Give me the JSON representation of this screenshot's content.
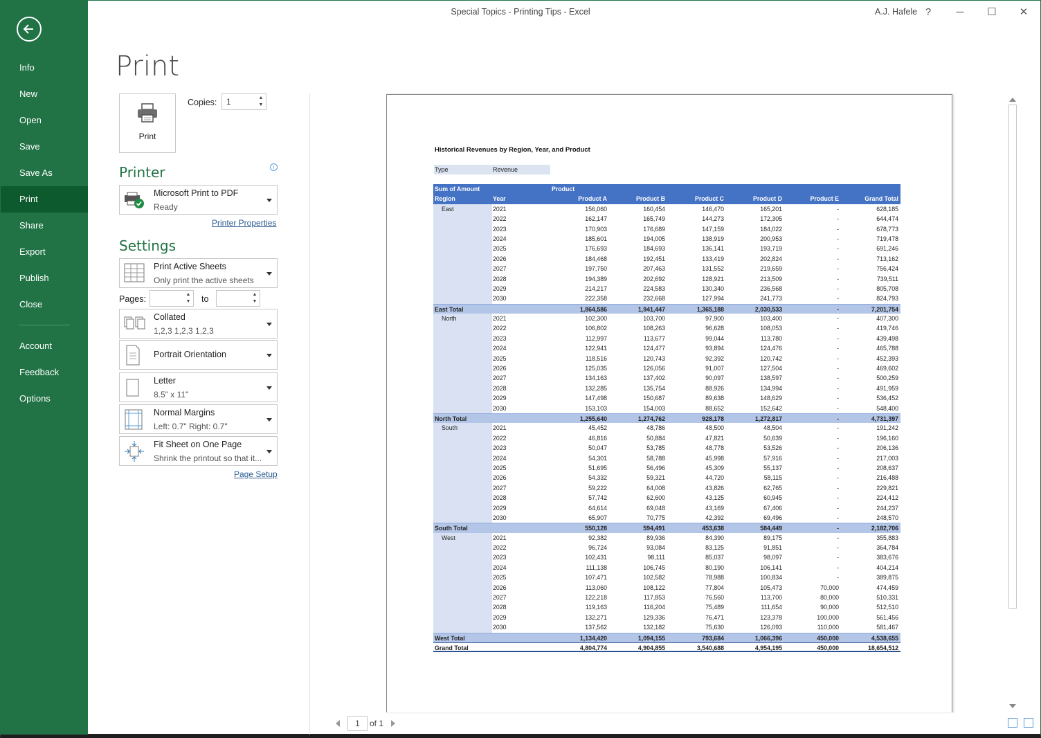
{
  "window": {
    "title": "Special Topics - Printing Tips  -  Excel",
    "user": "A.J. Hafele",
    "help": "?",
    "minimize": "─",
    "maximize": "☐",
    "close": "✕"
  },
  "nav": {
    "items": [
      {
        "label": "Info"
      },
      {
        "label": "New"
      },
      {
        "label": "Open"
      },
      {
        "label": "Save"
      },
      {
        "label": "Save As"
      },
      {
        "label": "Print",
        "active": true
      },
      {
        "label": "Share"
      },
      {
        "label": "Export"
      },
      {
        "label": "Publish"
      },
      {
        "label": "Close"
      },
      {
        "label": "Account"
      },
      {
        "label": "Feedback"
      },
      {
        "label": "Options"
      }
    ]
  },
  "print": {
    "heading": "Print",
    "button_label": "Print",
    "copies_label": "Copies:",
    "copies_value": "1",
    "printer_title": "Printer",
    "printer_name": "Microsoft Print to PDF",
    "printer_status": "Ready",
    "printer_properties": "Printer Properties",
    "settings_title": "Settings",
    "what_to_print": "Print Active Sheets",
    "what_to_print_desc": "Only print the active sheets",
    "pages_label": "Pages:",
    "pages_from": "",
    "pages_to_label": "to",
    "pages_to": "",
    "collation": "Collated",
    "collation_desc": "1,2,3    1,2,3    1,2,3",
    "orientation": "Portrait Orientation",
    "paper": "Letter",
    "paper_desc": "8.5\" x 11\"",
    "margins": "Normal Margins",
    "margins_desc": "Left:  0.7\"    Right:  0.7\"",
    "scaling": "Fit Sheet on One Page",
    "scaling_desc": "Shrink the printout so that it...",
    "page_setup": "Page Setup"
  },
  "pager": {
    "current": "1",
    "of": "of 1"
  },
  "report": {
    "title": "Historical Revenues by Region, Year, and Product",
    "type_label": "Type",
    "type_value": "Revenue",
    "header1": {
      "a": "Sum of Amount",
      "b": "Product"
    },
    "header2": [
      "Region",
      "Year",
      "Product A",
      "Product B",
      "Product C",
      "Product D",
      "Product E",
      "Grand Total"
    ],
    "rows": [
      {
        "kind": "dat",
        "cells": [
          "East",
          "2021",
          "156,060",
          "160,454",
          "146,470",
          "165,201",
          "-",
          "628,185"
        ]
      },
      {
        "kind": "dat",
        "cells": [
          "",
          "2022",
          "162,147",
          "165,749",
          "144,273",
          "172,305",
          "-",
          "644,474"
        ]
      },
      {
        "kind": "dat",
        "cells": [
          "",
          "2023",
          "170,903",
          "176,689",
          "147,159",
          "184,022",
          "-",
          "678,773"
        ]
      },
      {
        "kind": "dat",
        "cells": [
          "",
          "2024",
          "185,601",
          "194,005",
          "138,919",
          "200,953",
          "-",
          "719,478"
        ]
      },
      {
        "kind": "dat",
        "cells": [
          "",
          "2025",
          "176,693",
          "184,693",
          "136,141",
          "193,719",
          "-",
          "691,246"
        ]
      },
      {
        "kind": "dat",
        "cells": [
          "",
          "2026",
          "184,468",
          "192,451",
          "133,419",
          "202,824",
          "-",
          "713,162"
        ]
      },
      {
        "kind": "dat",
        "cells": [
          "",
          "2027",
          "197,750",
          "207,463",
          "131,552",
          "219,659",
          "-",
          "756,424"
        ]
      },
      {
        "kind": "dat",
        "cells": [
          "",
          "2028",
          "194,389",
          "202,692",
          "128,921",
          "213,509",
          "-",
          "739,511"
        ]
      },
      {
        "kind": "dat",
        "cells": [
          "",
          "2029",
          "214,217",
          "224,583",
          "130,340",
          "236,568",
          "-",
          "805,708"
        ]
      },
      {
        "kind": "dat",
        "cells": [
          "",
          "2030",
          "222,358",
          "232,668",
          "127,994",
          "241,773",
          "-",
          "824,793"
        ]
      },
      {
        "kind": "sub",
        "cells": [
          "East Total",
          "",
          "1,864,586",
          "1,941,447",
          "1,365,188",
          "2,030,533",
          "-",
          "7,201,754"
        ]
      },
      {
        "kind": "dat",
        "cells": [
          "North",
          "2021",
          "102,300",
          "103,700",
          "97,900",
          "103,400",
          "-",
          "407,300"
        ]
      },
      {
        "kind": "dat",
        "cells": [
          "",
          "2022",
          "106,802",
          "108,263",
          "96,628",
          "108,053",
          "-",
          "419,746"
        ]
      },
      {
        "kind": "dat",
        "cells": [
          "",
          "2023",
          "112,997",
          "113,677",
          "99,044",
          "113,780",
          "-",
          "439,498"
        ]
      },
      {
        "kind": "dat",
        "cells": [
          "",
          "2024",
          "122,941",
          "124,477",
          "93,894",
          "124,476",
          "-",
          "465,788"
        ]
      },
      {
        "kind": "dat",
        "cells": [
          "",
          "2025",
          "118,516",
          "120,743",
          "92,392",
          "120,742",
          "-",
          "452,393"
        ]
      },
      {
        "kind": "dat",
        "cells": [
          "",
          "2026",
          "125,035",
          "126,056",
          "91,007",
          "127,504",
          "-",
          "469,602"
        ]
      },
      {
        "kind": "dat",
        "cells": [
          "",
          "2027",
          "134,163",
          "137,402",
          "90,097",
          "138,597",
          "-",
          "500,259"
        ]
      },
      {
        "kind": "dat",
        "cells": [
          "",
          "2028",
          "132,285",
          "135,754",
          "88,926",
          "134,994",
          "-",
          "491,959"
        ]
      },
      {
        "kind": "dat",
        "cells": [
          "",
          "2029",
          "147,498",
          "150,687",
          "89,638",
          "148,629",
          "-",
          "536,452"
        ]
      },
      {
        "kind": "dat",
        "cells": [
          "",
          "2030",
          "153,103",
          "154,003",
          "88,652",
          "152,642",
          "-",
          "548,400"
        ]
      },
      {
        "kind": "sub",
        "cells": [
          "North Total",
          "",
          "1,255,640",
          "1,274,762",
          "928,178",
          "1,272,817",
          "-",
          "4,731,397"
        ]
      },
      {
        "kind": "dat",
        "cells": [
          "South",
          "2021",
          "45,452",
          "48,786",
          "48,500",
          "48,504",
          "-",
          "191,242"
        ]
      },
      {
        "kind": "dat",
        "cells": [
          "",
          "2022",
          "46,816",
          "50,884",
          "47,821",
          "50,639",
          "-",
          "196,160"
        ]
      },
      {
        "kind": "dat",
        "cells": [
          "",
          "2023",
          "50,047",
          "53,785",
          "48,778",
          "53,526",
          "-",
          "206,136"
        ]
      },
      {
        "kind": "dat",
        "cells": [
          "",
          "2024",
          "54,301",
          "58,788",
          "45,998",
          "57,916",
          "-",
          "217,003"
        ]
      },
      {
        "kind": "dat",
        "cells": [
          "",
          "2025",
          "51,695",
          "56,496",
          "45,309",
          "55,137",
          "-",
          "208,637"
        ]
      },
      {
        "kind": "dat",
        "cells": [
          "",
          "2026",
          "54,332",
          "59,321",
          "44,720",
          "58,115",
          "-",
          "216,488"
        ]
      },
      {
        "kind": "dat",
        "cells": [
          "",
          "2027",
          "59,222",
          "64,008",
          "43,826",
          "62,765",
          "-",
          "229,821"
        ]
      },
      {
        "kind": "dat",
        "cells": [
          "",
          "2028",
          "57,742",
          "62,600",
          "43,125",
          "60,945",
          "-",
          "224,412"
        ]
      },
      {
        "kind": "dat",
        "cells": [
          "",
          "2029",
          "64,614",
          "69,048",
          "43,169",
          "67,406",
          "-",
          "244,237"
        ]
      },
      {
        "kind": "dat",
        "cells": [
          "",
          "2030",
          "65,907",
          "70,775",
          "42,392",
          "69,496",
          "-",
          "248,570"
        ]
      },
      {
        "kind": "sub",
        "cells": [
          "South Total",
          "",
          "550,128",
          "594,491",
          "453,638",
          "584,449",
          "-",
          "2,182,706"
        ]
      },
      {
        "kind": "dat",
        "cells": [
          "West",
          "2021",
          "92,382",
          "89,936",
          "84,390",
          "89,175",
          "-",
          "355,883"
        ]
      },
      {
        "kind": "dat",
        "cells": [
          "",
          "2022",
          "96,724",
          "93,084",
          "83,125",
          "91,851",
          "-",
          "364,784"
        ]
      },
      {
        "kind": "dat",
        "cells": [
          "",
          "2023",
          "102,431",
          "98,111",
          "85,037",
          "98,097",
          "-",
          "383,676"
        ]
      },
      {
        "kind": "dat",
        "cells": [
          "",
          "2024",
          "111,138",
          "106,745",
          "80,190",
          "106,141",
          "-",
          "404,214"
        ]
      },
      {
        "kind": "dat",
        "cells": [
          "",
          "2025",
          "107,471",
          "102,582",
          "78,988",
          "100,834",
          "-",
          "389,875"
        ]
      },
      {
        "kind": "dat",
        "cells": [
          "",
          "2026",
          "113,060",
          "108,122",
          "77,804",
          "105,473",
          "70,000",
          "474,459"
        ]
      },
      {
        "kind": "dat",
        "cells": [
          "",
          "2027",
          "122,218",
          "117,853",
          "76,560",
          "113,700",
          "80,000",
          "510,331"
        ]
      },
      {
        "kind": "dat",
        "cells": [
          "",
          "2028",
          "119,163",
          "116,204",
          "75,489",
          "111,654",
          "90,000",
          "512,510"
        ]
      },
      {
        "kind": "dat",
        "cells": [
          "",
          "2029",
          "132,271",
          "129,336",
          "76,471",
          "123,378",
          "100,000",
          "561,456"
        ]
      },
      {
        "kind": "dat",
        "cells": [
          "",
          "2030",
          "137,562",
          "132,182",
          "75,630",
          "126,093",
          "110,000",
          "581,467"
        ]
      },
      {
        "kind": "sub",
        "cells": [
          "West Total",
          "",
          "1,134,420",
          "1,094,155",
          "793,684",
          "1,066,396",
          "450,000",
          "4,538,655"
        ]
      },
      {
        "kind": "grand",
        "cells": [
          "Grand Total",
          "",
          "4,804,774",
          "4,904,855",
          "3,540,688",
          "4,954,195",
          "450,000",
          "18,654,512"
        ]
      }
    ]
  }
}
